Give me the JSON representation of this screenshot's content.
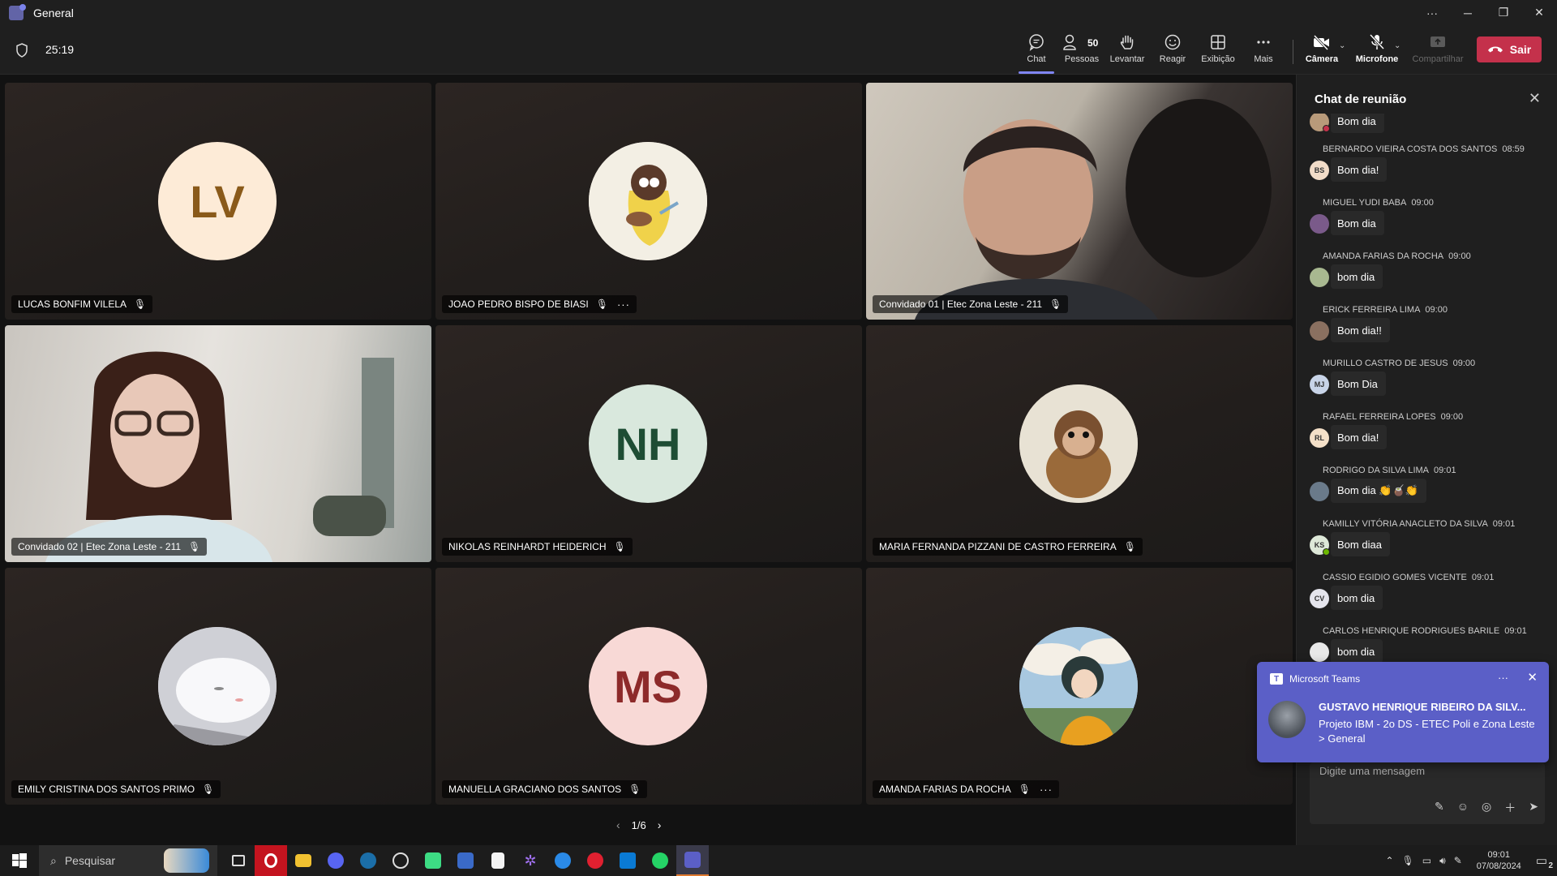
{
  "window": {
    "title": "General"
  },
  "meeting": {
    "timer": "25:19"
  },
  "toolbar": {
    "chat": "Chat",
    "people": "Pessoas",
    "people_count": "50",
    "raise": "Levantar",
    "react": "Reagir",
    "view": "Exibição",
    "more": "Mais",
    "camera": "Câmera",
    "mic": "Microfone",
    "share": "Compartilhar",
    "leave": "Sair"
  },
  "tiles": [
    {
      "name": "LUCAS BONFIM VILELA",
      "initials": "LV",
      "avatar_bg": "#fdebd7",
      "initials_color": "#8a5a1a"
    },
    {
      "name": "JOAO PEDRO BISPO DE BIASI",
      "initials": "",
      "avatar_bg": "#f3efe4"
    },
    {
      "name": "Convidado 01 | Etec Zona Leste - 211",
      "initials": ""
    },
    {
      "name": "Convidado 02 | Etec Zona Leste - 211",
      "initials": ""
    },
    {
      "name": "NIKOLAS REINHARDT HEIDERICH",
      "initials": "NH",
      "avatar_bg": "#d9e8dd",
      "initials_color": "#1e4d34"
    },
    {
      "name": "MARIA FERNANDA PIZZANI DE CASTRO FERREIRA",
      "initials": "",
      "avatar_bg": "#cfc6b4"
    },
    {
      "name": "EMILY CRISTINA DOS SANTOS PRIMO",
      "initials": "",
      "avatar_bg": "#e9e9ee"
    },
    {
      "name": "MANUELLA GRACIANO DOS SANTOS",
      "initials": "MS",
      "avatar_bg": "#f8d9d6",
      "initials_color": "#8d2a2a"
    },
    {
      "name": "AMANDA FARIAS DA ROCHA",
      "initials": "",
      "avatar_bg": "#c8d8e0"
    }
  ],
  "pager": {
    "label": "1/6"
  },
  "chat": {
    "title": "Chat de reunião",
    "compose_placeholder": "Digite uma mensagem",
    "messages": [
      {
        "author": "",
        "time": "",
        "text": "Bom dia",
        "initials": ""
      },
      {
        "author": "BERNARDO VIEIRA COSTA DOS SANTOS",
        "time": "08:59",
        "text": "Bom dia!",
        "initials": "BS"
      },
      {
        "author": "MIGUEL YUDI BABA",
        "time": "09:00",
        "text": "Bom dia",
        "initials": ""
      },
      {
        "author": "AMANDA FARIAS DA ROCHA",
        "time": "09:00",
        "text": "bom dia",
        "initials": ""
      },
      {
        "author": "ERICK FERREIRA LIMA",
        "time": "09:00",
        "text": "Bom dia!!",
        "initials": ""
      },
      {
        "author": "MURILLO CASTRO DE JESUS",
        "time": "09:00",
        "text": "Bom Dia",
        "initials": "MJ"
      },
      {
        "author": "RAFAEL FERREIRA LOPES",
        "time": "09:00",
        "text": "Bom dia!",
        "initials": "RL"
      },
      {
        "author": "RODRIGO DA SILVA LIMA",
        "time": "09:01",
        "text": "Bom dia 👏🧉👏",
        "initials": ""
      },
      {
        "author": "KAMILLY VITÓRIA ANACLETO DA SILVA",
        "time": "09:01",
        "text": "Bom diaa",
        "initials": "KS"
      },
      {
        "author": "CASSIO EGIDIO GOMES VICENTE",
        "time": "09:01",
        "text": "bom dia",
        "initials": "CV"
      },
      {
        "author": "CARLOS HENRIQUE RODRIGUES BARILE",
        "time": "09:01",
        "text": "bom dia",
        "initials": ""
      }
    ]
  },
  "toast": {
    "app": "Microsoft Teams",
    "from": "GUSTAVO HENRIQUE RIBEIRO DA SILV...",
    "body": "Projeto IBM - 2o DS - ETEC Poli e Zona Leste > General"
  },
  "taskbar": {
    "search_placeholder": "Pesquisar",
    "time": "09:01",
    "date": "07/08/2024",
    "notif_count": "2"
  },
  "colors": {
    "accent": "#5b5fc7",
    "leave": "#c4314b",
    "active_tab": "#7f85f5"
  }
}
